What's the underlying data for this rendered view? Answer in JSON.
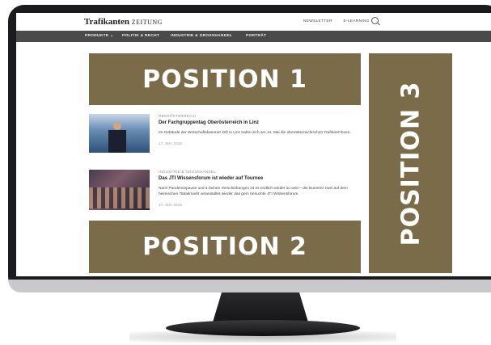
{
  "site": {
    "logo_bold": "Trafikanten",
    "logo_light": "ZEITUNG",
    "top_links": [
      "NEWSLETTER",
      "E-LEARNING"
    ]
  },
  "nav": {
    "items": [
      "PRODUKTE ⌄",
      "POLITIK & RECHT",
      "INDUSTRIE & GROSSHANDEL",
      "PORTRÄT"
    ]
  },
  "ad_positions": {
    "position_1": "POSITION 1",
    "position_2": "POSITION 2",
    "position_3": "POSITION 3"
  },
  "articles": [
    {
      "kicker": "OBERÖSTERREICH",
      "headline": "Der Fachgruppentag Oberösterreich in Linz",
      "teaser": "Im Gebäude der Wirtschaftskammer OÖ in Linz trafen sich am 14. Mai die oberösterreichischen Trafikant*innen.",
      "date": "17. MAI 2023"
    },
    {
      "kicker": "INDUSTRIE & GROSSHANDEL",
      "headline": "Das JTI Wissensforum ist wieder auf Tournee",
      "teaser": "Nach Pandemiepause und 4 fachen Verschiebungen ist es endlich wieder so weit – die Nummer zwei auf dem heimischen Tabakmarkt veranstaltet wieder das gern besuchte JTI Wissensforum.",
      "date": "17. MAI 2023"
    }
  ],
  "colors": {
    "ad_block": "#7b6c49",
    "nav_bar": "#4a4a4a",
    "monitor_bezel": "#1b1b1d"
  }
}
